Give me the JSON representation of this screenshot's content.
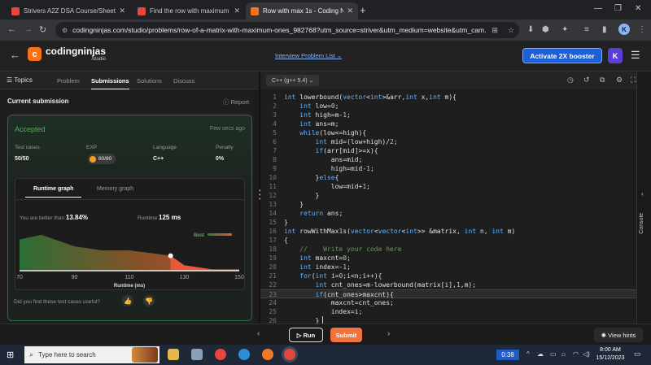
{
  "browser": {
    "tabs": [
      {
        "label": "Strivers A2Z DSA Course/Sheet",
        "active": false
      },
      {
        "label": "Find the row with maximum nu",
        "active": false
      },
      {
        "label": "Row with max 1s - Coding Ninj",
        "active": true
      }
    ],
    "url": "codingninjas.com/studio/problems/row-of-a-matrix-with-maximum-ones_982768?utm_source=striver&utm_medium=website&utm_cam...",
    "profile_initial": "K"
  },
  "header": {
    "logo_name": "codingninjas",
    "logo_sub": "/studio",
    "problem_list_link": "Interview Problem List",
    "booster_button": "Activate 2X booster",
    "user_initial": "K"
  },
  "panel_tabs": {
    "topics": "Topics",
    "problem": "Problem",
    "submissions": "Submissions",
    "solutions": "Solutions",
    "discuss": "Discuss"
  },
  "submission": {
    "title": "Current submission",
    "report": "Report",
    "status": "Accepted",
    "time_ago": "Few secs ago",
    "stats": {
      "test_cases_label": "Test cases",
      "test_cases_value": "50/50",
      "exp_label": "EXP",
      "exp_value": "80/80",
      "language_label": "Language",
      "language_value": "C++",
      "penalty_label": "Penalty",
      "penalty_value": "0%"
    },
    "graph_tabs": {
      "runtime": "Runtime graph",
      "memory": "Memory graph"
    },
    "better_label": "You are better than",
    "better_value": "13.84%",
    "runtime_label": "Runtime",
    "runtime_value": "125 ms",
    "feedback": "Did you find these test cases useful?"
  },
  "chart_data": {
    "type": "area",
    "xlabel": "Runtime (ms)",
    "x_ticks": [
      "70",
      "90",
      "110",
      "130",
      "150"
    ],
    "xlim": [
      70,
      150
    ],
    "x": [
      70,
      78,
      90,
      100,
      110,
      118,
      125,
      130,
      140,
      150
    ],
    "values": [
      0.46,
      0.53,
      0.36,
      0.3,
      0.3,
      0.26,
      0.22,
      0.08,
      0.02,
      0.02
    ],
    "highlight_x": 125,
    "legend_label": "Best",
    "colors": {
      "low": "#2f7d3a",
      "mid": "#9a5a2a",
      "high": "#e8593a"
    }
  },
  "editor": {
    "language": "C++ (g++ 5.4)",
    "active_line": 23,
    "lines": [
      "int lowerbound(vector<int>&arr,int x,int m){",
      "    int low=0;",
      "    int high=m-1;",
      "    int ans=m;",
      "    while(low<=high){",
      "        int mid=(low+high)/2;",
      "        if(arr[mid]>=x){",
      "            ans=mid;",
      "            high=mid-1;",
      "        }else{",
      "            low=mid+1;",
      "        }",
      "    }",
      "    return ans;",
      "}",
      "int rowWithMax1s(vector<vector<int>> &matrix, int n, int m)",
      "{",
      "    //    Write your code here",
      "    int maxcnt=0;",
      "    int index=-1;",
      "    for(int i=0;i<n;i++){",
      "        int cnt_ones=m-lowerbound(matrix[i],1,m);",
      "        if(cnt_ones>maxcnt){",
      "            maxcnt=cnt_ones;",
      "            index=i;",
      "        }"
    ],
    "console_label": "Console"
  },
  "actions": {
    "run": "Run",
    "submit": "Submit",
    "hints": "View hints"
  },
  "taskbar": {
    "search_placeholder": "Type here to search",
    "timer": "0:38",
    "time": "8:00 AM",
    "date": "15/12/2023"
  }
}
